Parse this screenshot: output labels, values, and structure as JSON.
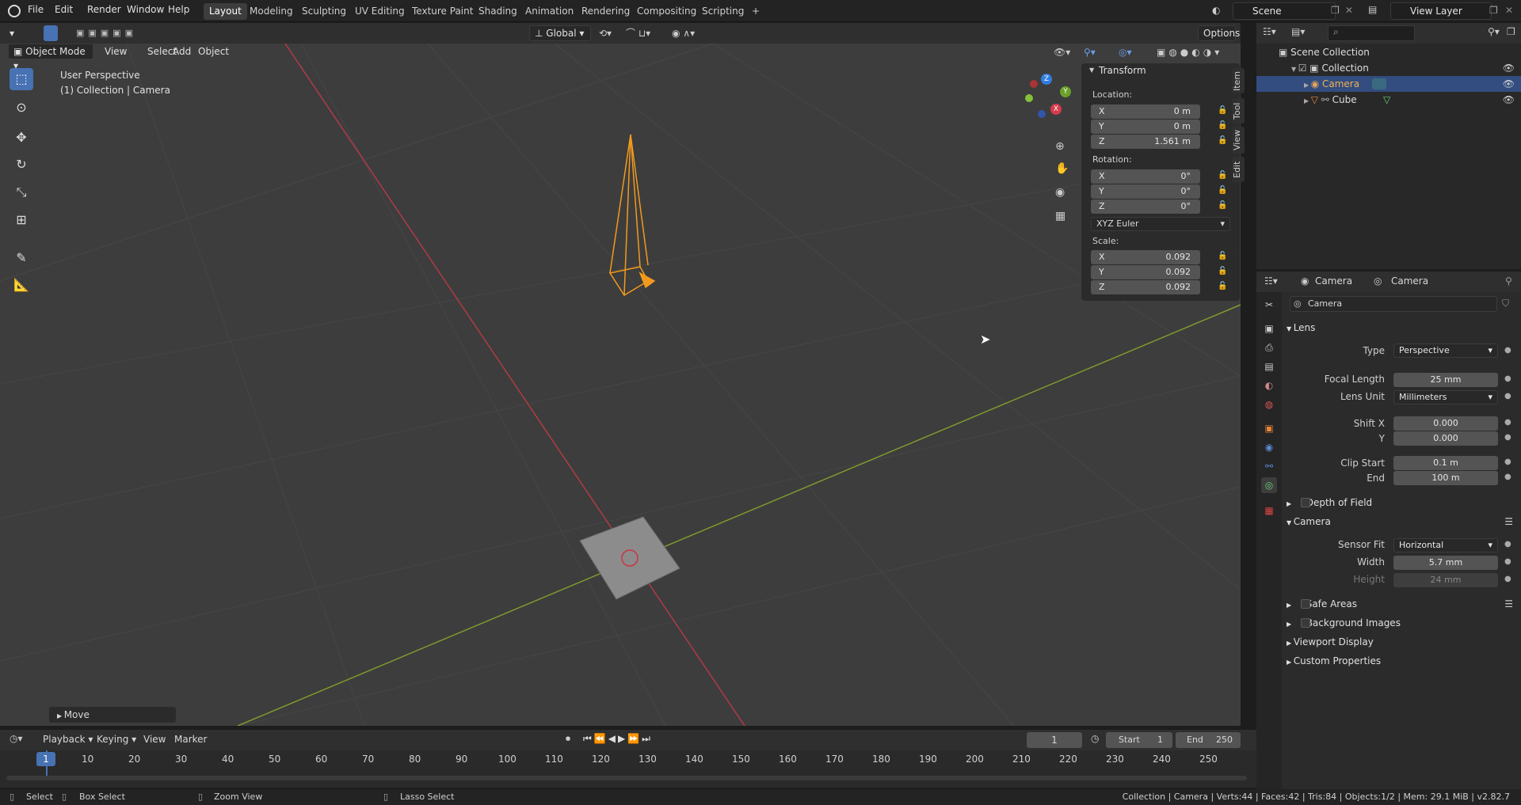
{
  "topbar": {
    "menus": [
      "File",
      "Edit",
      "Render",
      "Window",
      "Help"
    ],
    "workspaces": [
      "Layout",
      "Modeling",
      "Sculpting",
      "UV Editing",
      "Texture Paint",
      "Shading",
      "Animation",
      "Rendering",
      "Compositing",
      "Scripting"
    ],
    "active_workspace": "Layout",
    "add_tab": "+",
    "scene": "Scene",
    "view_layer": "View Layer"
  },
  "viewport_header": {
    "mode": "Object Mode",
    "menus": [
      "View",
      "Select",
      "Add",
      "Object"
    ],
    "transform_orientation": "Global",
    "options": "Options"
  },
  "viewport": {
    "view_name": "User Perspective",
    "collection_info": "(1) Collection | Camera",
    "gizmo_axes": [
      "X",
      "Y",
      "Z"
    ],
    "last_op": "Move"
  },
  "npanel": {
    "title": "Transform",
    "location_label": "Location:",
    "location": [
      {
        "axis": "X",
        "value": "0 m"
      },
      {
        "axis": "Y",
        "value": "0 m"
      },
      {
        "axis": "Z",
        "value": "1.561 m"
      }
    ],
    "rotation_label": "Rotation:",
    "rotation": [
      {
        "axis": "X",
        "value": "0°"
      },
      {
        "axis": "Y",
        "value": "0°"
      },
      {
        "axis": "Z",
        "value": "0°"
      }
    ],
    "rotation_mode": "XYZ Euler",
    "scale_label": "Scale:",
    "scale": [
      {
        "axis": "X",
        "value": "0.092"
      },
      {
        "axis": "Y",
        "value": "0.092"
      },
      {
        "axis": "Z",
        "value": "0.092"
      }
    ],
    "side_tabs": [
      "Item",
      "Tool",
      "View",
      "Edit"
    ]
  },
  "outliner": {
    "rows": [
      {
        "label": "Scene Collection",
        "indent": 0,
        "selected": false
      },
      {
        "label": "Collection",
        "indent": 1,
        "selected": false
      },
      {
        "label": "Camera",
        "indent": 2,
        "selected": true
      },
      {
        "label": "Cube",
        "indent": 2,
        "selected": false
      }
    ]
  },
  "properties": {
    "breadcrumb_object": "Camera",
    "breadcrumb_data": "Camera",
    "datablock": "Camera",
    "lens_section": "Lens",
    "type_label": "Type",
    "type_value": "Perspective",
    "focal_label": "Focal Length",
    "focal_value": "25 mm",
    "lens_unit_label": "Lens Unit",
    "lens_unit_value": "Millimeters",
    "shiftx_label": "Shift X",
    "shiftx_value": "0.000",
    "shifty_label": "Y",
    "shifty_value": "0.000",
    "clip_start_label": "Clip Start",
    "clip_start_value": "0.1 m",
    "clip_end_label": "End",
    "clip_end_value": "100 m",
    "dof_section": "Depth of Field",
    "camera_section": "Camera",
    "sensor_fit_label": "Sensor Fit",
    "sensor_fit_value": "Horizontal",
    "width_label": "Width",
    "width_value": "5.7 mm",
    "height_label": "Height",
    "height_value": "24 mm",
    "safe_areas": "Safe Areas",
    "bg_images": "Background Images",
    "viewport_display": "Viewport Display",
    "custom_props": "Custom Properties"
  },
  "timeline": {
    "menus": [
      "Playback",
      "Keying",
      "View",
      "Marker"
    ],
    "current_frame": "1",
    "start_label": "Start",
    "start": "1",
    "end_label": "End",
    "end": "250",
    "ticks": [
      "1",
      "10",
      "20",
      "30",
      "40",
      "50",
      "60",
      "70",
      "80",
      "90",
      "100",
      "110",
      "120",
      "130",
      "140",
      "150",
      "160",
      "170",
      "180",
      "190",
      "200",
      "210",
      "220",
      "230",
      "240",
      "250"
    ]
  },
  "statusbar": {
    "select": "Select",
    "box_select": "Box Select",
    "zoom_view": "Zoom View",
    "lasso_select": "Lasso Select",
    "stats": "Collection | Camera | Verts:44 | Faces:42 | Tris:84 | Objects:1/2 | Mem: 29.1 MiB | v2.82.7"
  }
}
